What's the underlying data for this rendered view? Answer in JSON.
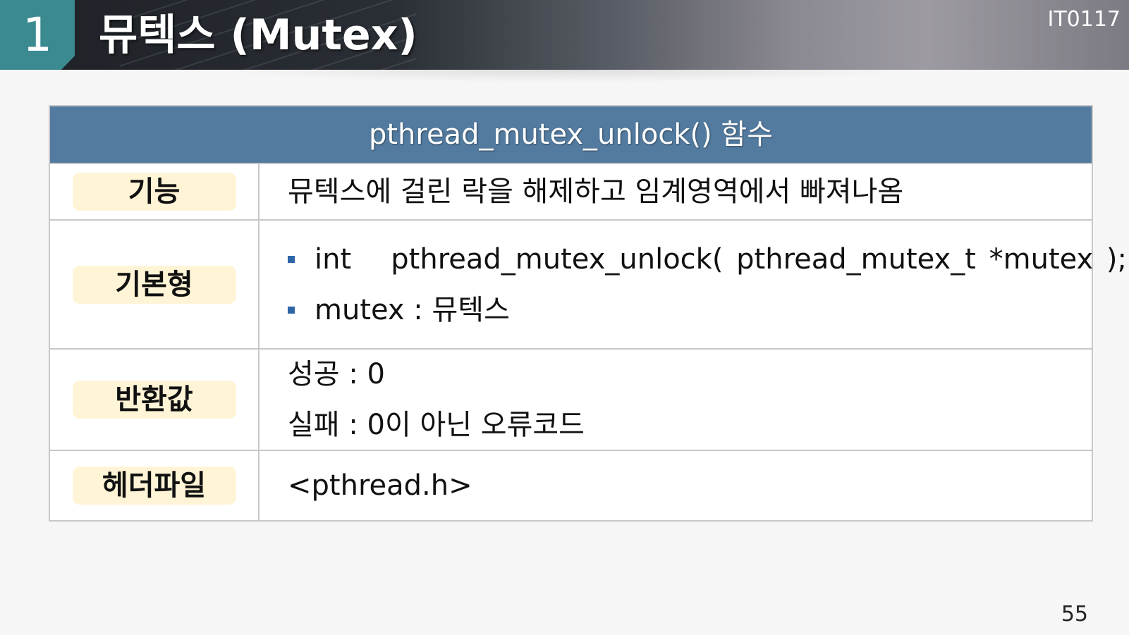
{
  "header": {
    "section_number": "1",
    "title": "뮤텍스 (Mutex)",
    "course_code": "IT0117"
  },
  "table": {
    "heading": "pthread_mutex_unlock() 함수",
    "rows": {
      "function": {
        "label": "기능",
        "text": "뮤텍스에 걸린 락을 해제하고 임계영역에서 빠져나옴"
      },
      "prototype": {
        "label": "기본형",
        "signature": "int   pthread_mutex_unlock( pthread_mutex_t *mutex );",
        "param": "mutex : 뮤텍스"
      },
      "return": {
        "label": "반환값",
        "success": "성공 : 0",
        "failure": "실패 : 0이 아닌 오류코드"
      },
      "header_file": {
        "label": "헤더파일",
        "text": "<pthread.h>"
      }
    }
  },
  "page_number": "55",
  "colors": {
    "header_accent": "#3a8a8f",
    "table_heading_bg": "#537b9f",
    "label_pill_bg": "#fff4d6",
    "bullet": "#2d66a8"
  }
}
